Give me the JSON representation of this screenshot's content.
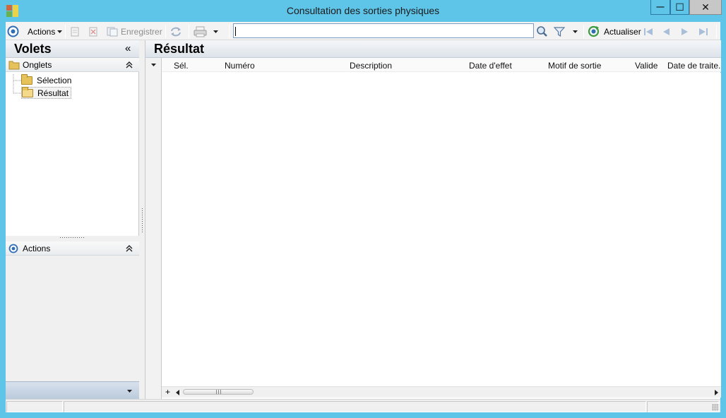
{
  "window": {
    "title": "Consultation des sorties physiques",
    "controls": {
      "minimize": "—",
      "maximize": "☐",
      "close": "✕"
    }
  },
  "toolbar": {
    "actions_label": "Actions",
    "save_label": "Enregistrer",
    "refresh_label": "Actualiser",
    "search_value": "",
    "icons": [
      "settings-icon",
      "new-icon",
      "delete-icon",
      "save-icon",
      "sync-icon",
      "print-icon",
      "search-icon",
      "filter-icon",
      "refresh-icon",
      "first-icon",
      "prev-icon",
      "next-icon",
      "last-icon"
    ]
  },
  "left_pane": {
    "title": "Volets",
    "collapse_glyph": "«",
    "tabs_section": {
      "title": "Onglets",
      "items": [
        {
          "label": "Sélection"
        },
        {
          "label": "Résultat"
        }
      ]
    },
    "actions_section": {
      "title": "Actions"
    }
  },
  "result_pane": {
    "title": "Résultat",
    "columns": [
      "Sél.",
      "Numéro",
      "Description",
      "Date d'effet",
      "Motif de sortie",
      "Valide",
      "Date de traite."
    ],
    "rows": []
  },
  "statusbar": {
    "cells": [
      "",
      "",
      ""
    ]
  },
  "colors": {
    "titlebar": "#5ec4e8",
    "accent": "#2f6db5"
  }
}
